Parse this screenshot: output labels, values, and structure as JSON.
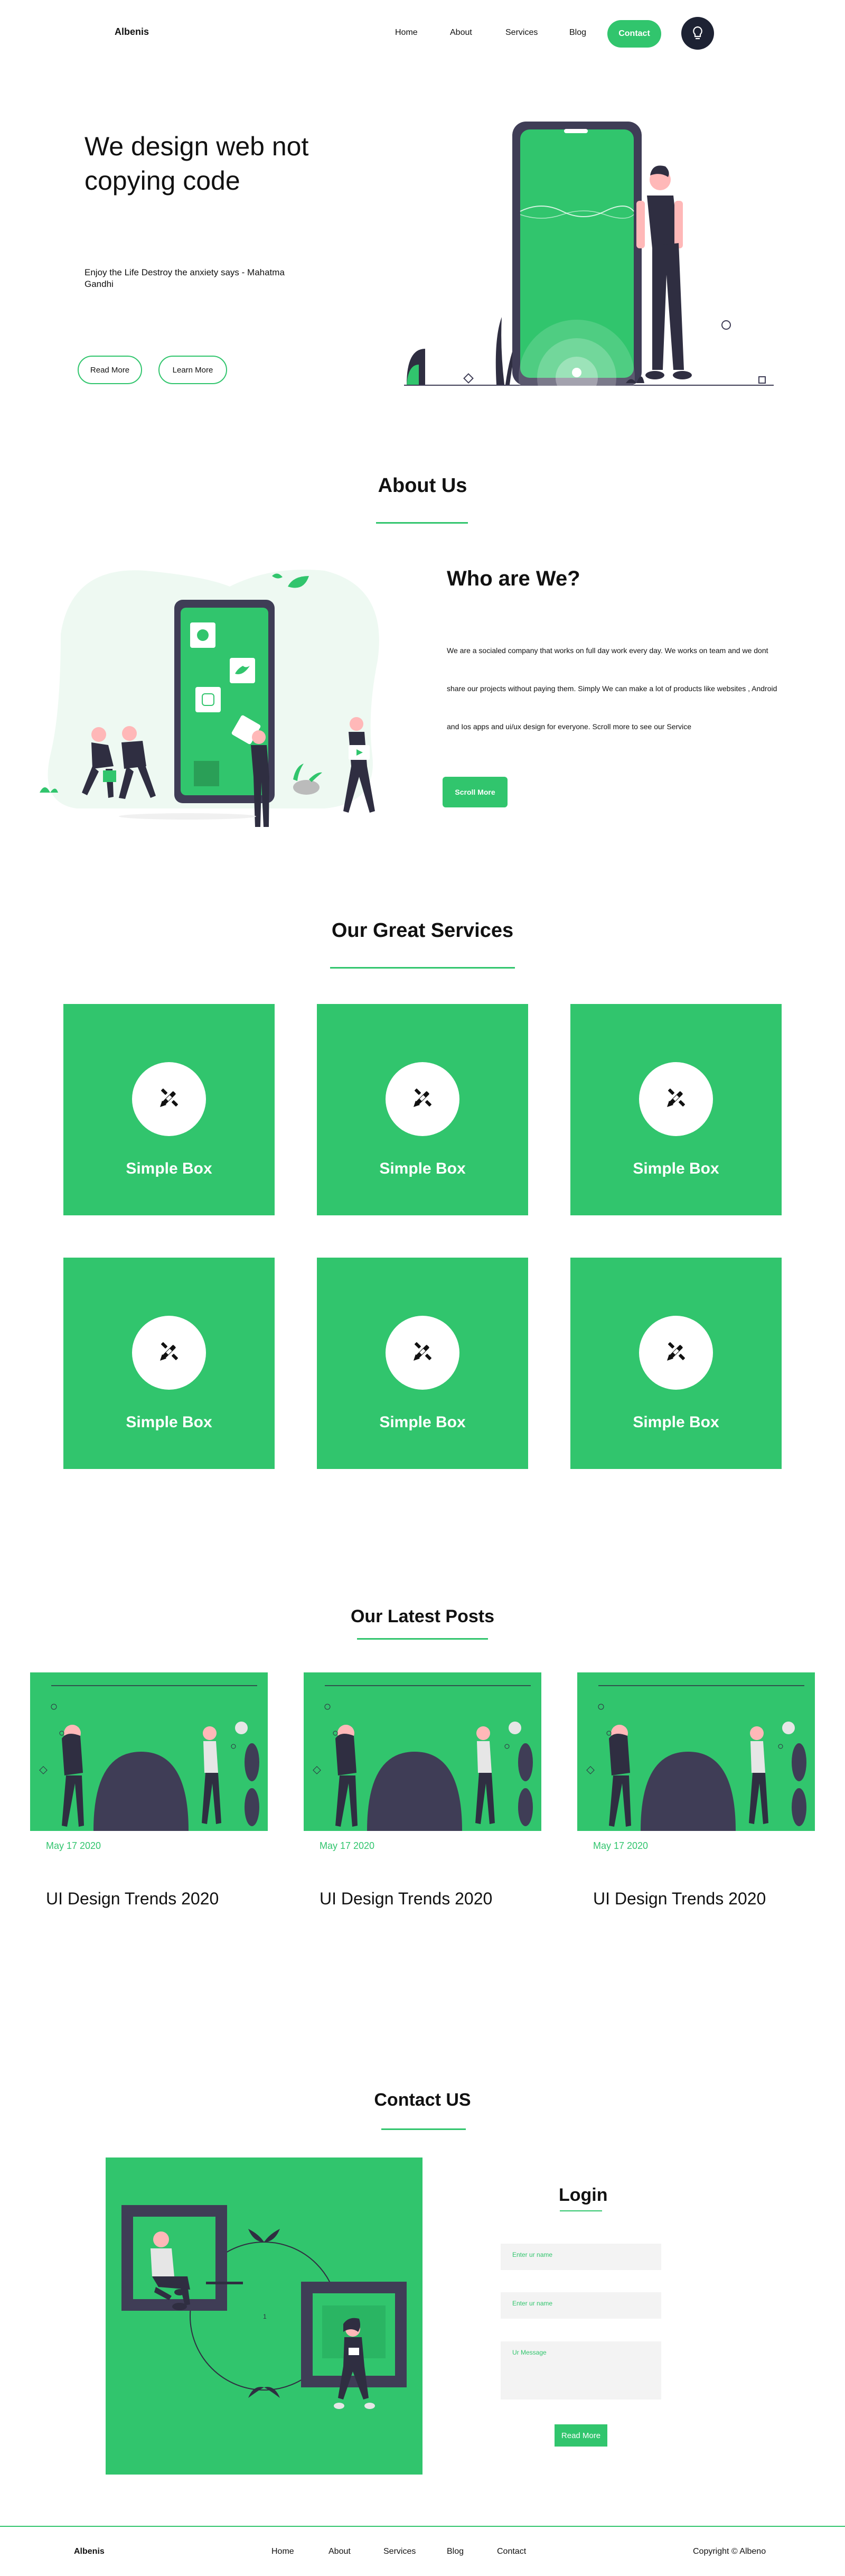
{
  "header": {
    "logo": "Albenis",
    "nav": [
      "Home",
      "About",
      "Services",
      "Blog"
    ],
    "contact": "Contact",
    "theme_icon": "lightbulb-icon"
  },
  "hero": {
    "title": "We design web not copying code",
    "subtitle": "Enjoy the Life Destroy the anxiety says - Mahatma Gandhi",
    "read_more": "Read More",
    "learn_more": "Learn More"
  },
  "about": {
    "heading": "About Us",
    "who_title": "Who are We?",
    "text_lines": [
      "We are a socialed company that works on full day work every day. We works on team and we dont",
      "share our projects without paying them. Simply We can make a lot of products like websites , Android",
      "and Ios apps and ui/ux design for everyone. Scroll more to see our Service"
    ],
    "scroll_more": "Scroll More"
  },
  "services": {
    "heading": "Our Great Services",
    "boxes": [
      {
        "label": "Simple Box",
        "icon": "design-tools-icon"
      },
      {
        "label": "Simple Box",
        "icon": "design-tools-icon"
      },
      {
        "label": "Simple Box",
        "icon": "design-tools-icon"
      },
      {
        "label": "Simple Box",
        "icon": "design-tools-icon"
      },
      {
        "label": "Simple Box",
        "icon": "design-tools-icon"
      },
      {
        "label": "Simple Box",
        "icon": "design-tools-icon"
      }
    ]
  },
  "posts": {
    "heading": "Our Latest Posts",
    "items": [
      {
        "date": "May 17 2020",
        "title": "UI Design Trends 2020"
      },
      {
        "date": "May 17 2020",
        "title": "UI Design Trends 2020"
      },
      {
        "date": "May 17 2020",
        "title": "UI Design Trends 2020"
      }
    ]
  },
  "contact": {
    "heading": "Contact US",
    "login_title": "Login",
    "name_placeholder": "Enter ur name",
    "email_placeholder": "Enter ur name",
    "message_placeholder": "Ur Message",
    "send": "Read More"
  },
  "footer": {
    "logo": "Albenis",
    "nav": [
      "Home",
      "About",
      "Services",
      "Blog",
      "Contact"
    ],
    "copyright": "Copyright © Albeno"
  },
  "colors": {
    "accent": "#31c56d",
    "dark": "#2f2e41",
    "theme_button": "#1d2233"
  }
}
